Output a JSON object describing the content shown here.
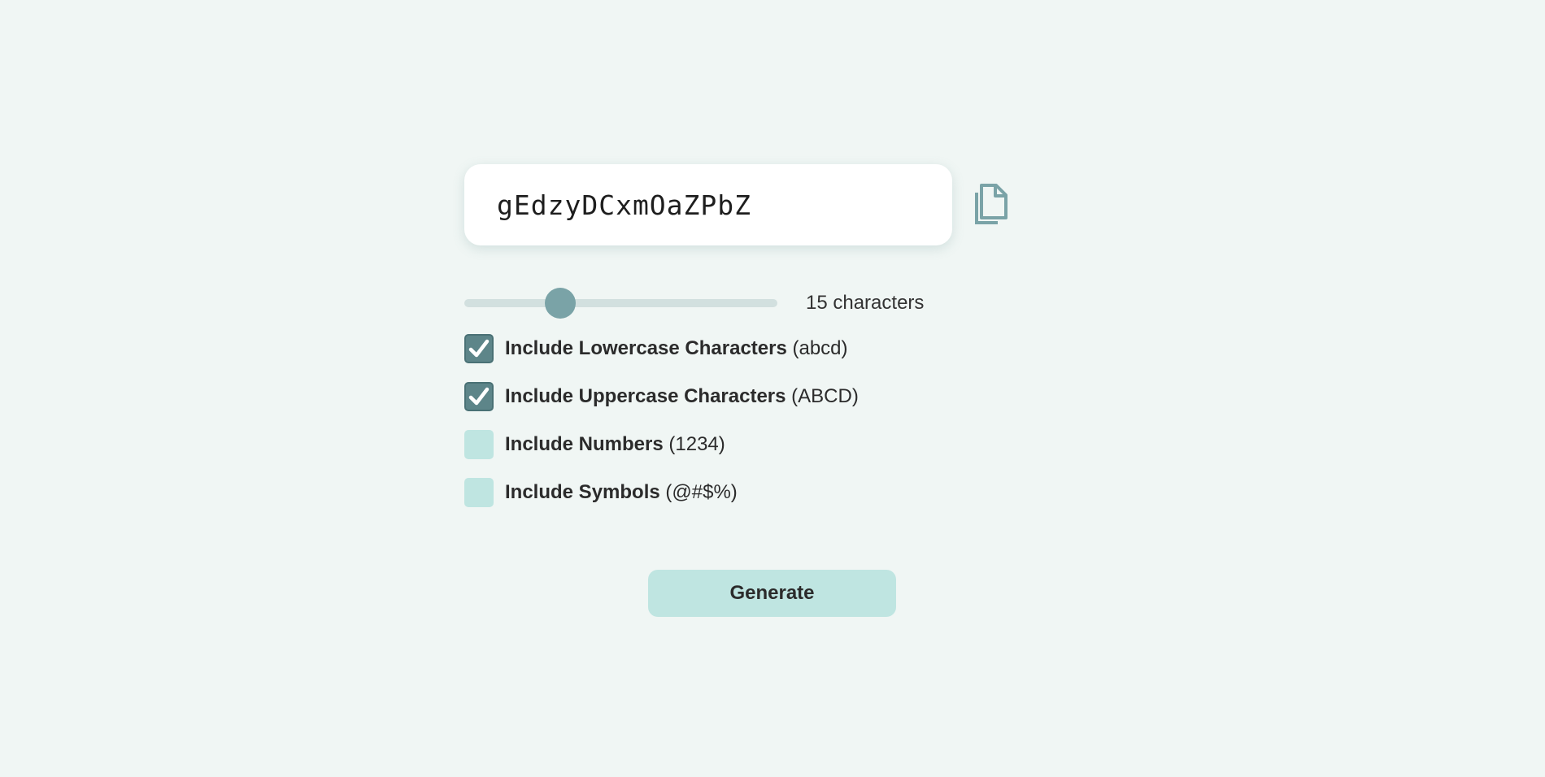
{
  "password": {
    "value": "gEdzyDCxmOaZPbZ"
  },
  "copy_button": {
    "icon": "copy-icon",
    "color": "#7aa3a7"
  },
  "length": {
    "value": 15,
    "min": 4,
    "max": 40,
    "label": "15 characters"
  },
  "options": [
    {
      "label": "Include Lowercase Characters",
      "hint": " (abcd)",
      "checked": true
    },
    {
      "label": "Include Uppercase Characters",
      "hint": " (ABCD)",
      "checked": true
    },
    {
      "label": "Include Numbers",
      "hint": " (1234)",
      "checked": false
    },
    {
      "label": "Include Symbols",
      "hint": " (@#$%)",
      "checked": false
    }
  ],
  "generate_button": {
    "label": "Generate"
  },
  "colors": {
    "background": "#f0f6f4",
    "accent": "#5d8589",
    "accent_light": "#bfe5e1",
    "slider_thumb": "#7aa3a7",
    "slider_track": "#d2e0df"
  }
}
